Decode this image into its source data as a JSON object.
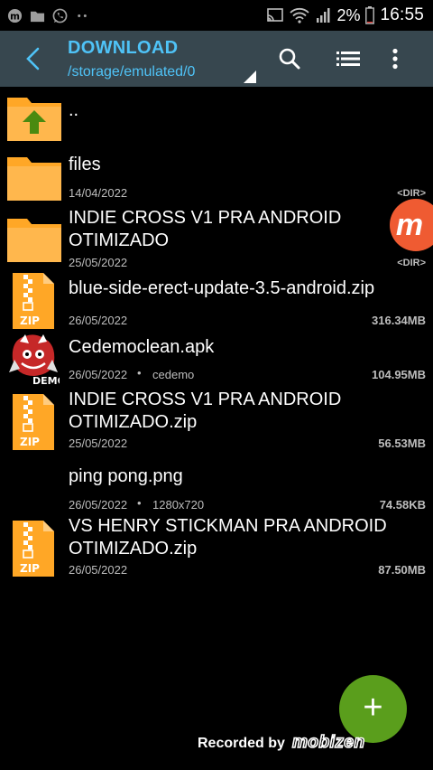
{
  "statusbar": {
    "battery": "2%",
    "time": "16:55"
  },
  "toolbar": {
    "title": "DOWNLOAD",
    "path": "/storage/emulated/0"
  },
  "files": [
    {
      "name": "..",
      "type": "parent",
      "date": "",
      "meta": "",
      "size": ""
    },
    {
      "name": "files",
      "type": "folder",
      "date": "14/04/2022",
      "meta": "",
      "size": "<DIR>"
    },
    {
      "name": "INDIE CROSS V1 PRA ANDROID OTIMIZADO",
      "type": "folder",
      "date": "25/05/2022",
      "meta": "",
      "size": "<DIR>"
    },
    {
      "name": "blue-side-erect-update-3.5-android.zip",
      "type": "zip",
      "date": "26/05/2022",
      "meta": "",
      "size": "316.34MB"
    },
    {
      "name": "Cedemoclean.apk",
      "type": "apk",
      "date": "26/05/2022",
      "meta": "cedemo",
      "size": "104.95MB"
    },
    {
      "name": "INDIE CROSS V1 PRA ANDROID OTIMIZADO.zip",
      "type": "zip",
      "date": "25/05/2022",
      "meta": "",
      "size": "56.53MB"
    },
    {
      "name": "ping pong.png",
      "type": "image",
      "date": "26/05/2022",
      "meta": "1280x720",
      "size": "74.58KB"
    },
    {
      "name": "VS HENRY STICKMAN PRA ANDROID OTIMIZADO.zip",
      "type": "zip",
      "date": "26/05/2022",
      "meta": "",
      "size": "87.50MB"
    }
  ],
  "icons": {
    "zip_label": "ZIP",
    "apk_label": "DEMO"
  },
  "fab": {
    "label": "+"
  },
  "bubble": {
    "label": "m"
  },
  "watermark": {
    "text": "Recorded by",
    "logo": "mobizen"
  },
  "colors": {
    "toolbar": "#37474f",
    "accent": "#4fc3f7",
    "folder": "#ffa726",
    "fab": "#5a9e1c",
    "bubble": "#ef5b32"
  }
}
